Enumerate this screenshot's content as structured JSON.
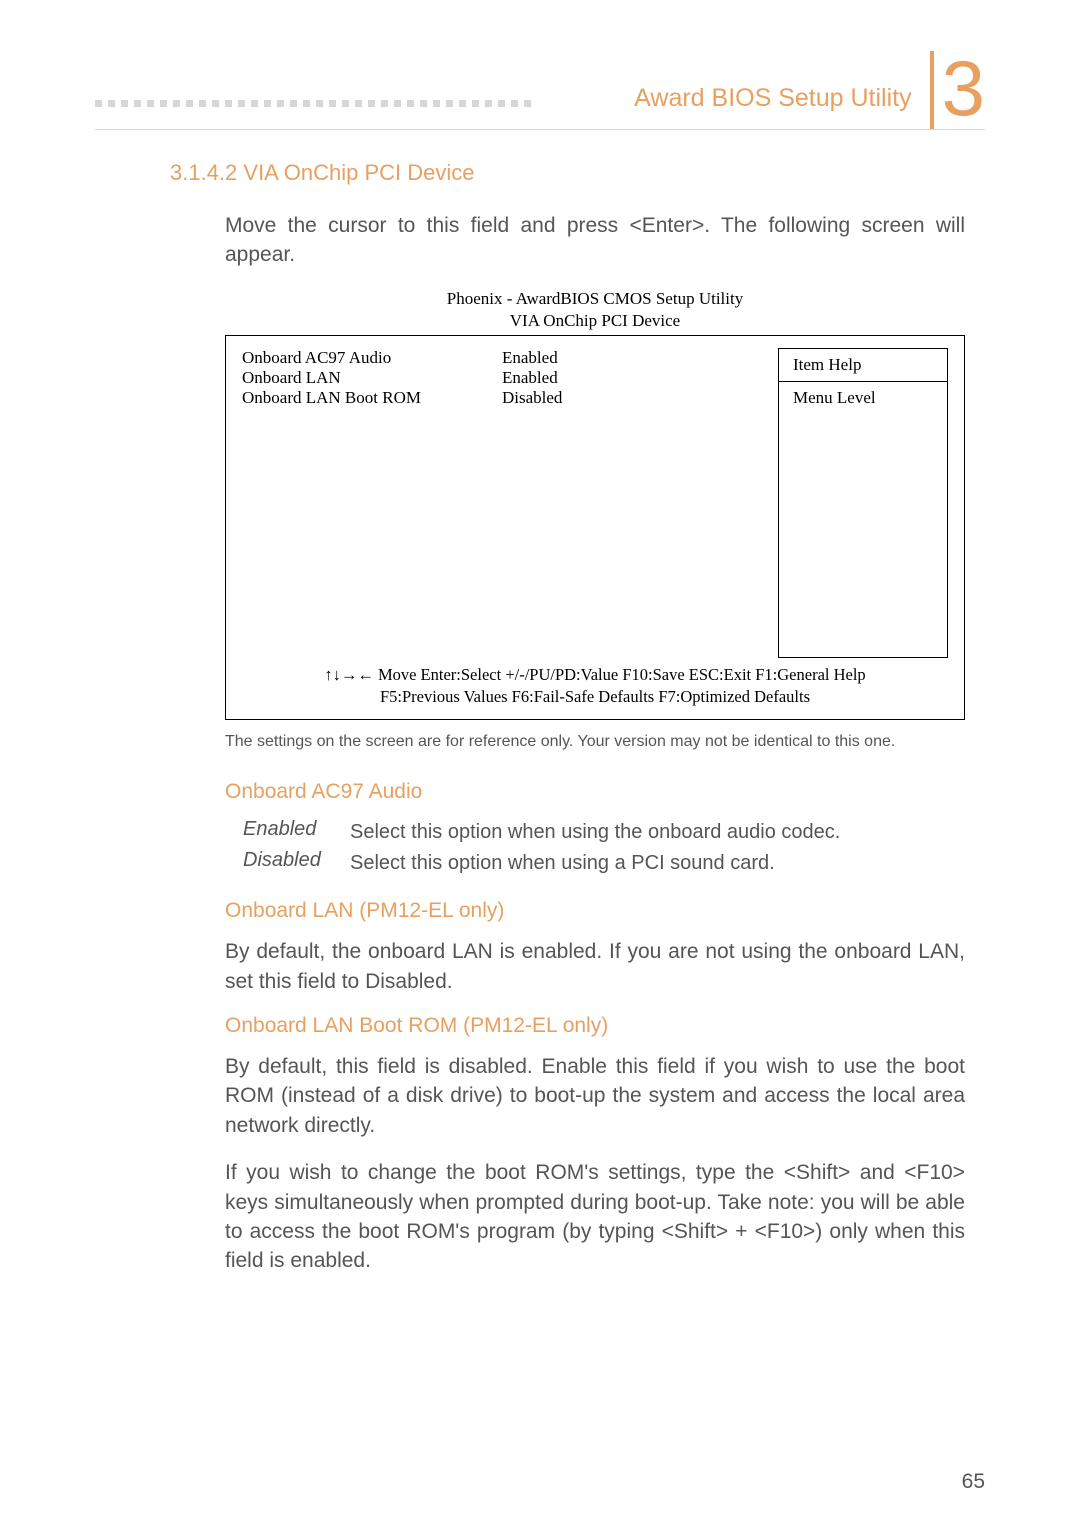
{
  "header": {
    "title": "Award BIOS Setup Utility",
    "chapter_number": "3"
  },
  "section": {
    "number_title": "3.1.4.2  VIA OnChip PCI Device",
    "intro": "Move the cursor to this field and press <Enter>. The following screen will appear."
  },
  "bios": {
    "title_line1": "Phoenix - AwardBIOS CMOS Setup Utility",
    "title_line2": "VIA OnChip PCI Device",
    "rows": [
      {
        "label": "Onboard AC97 Audio",
        "value": "Enabled"
      },
      {
        "label": "Onboard LAN",
        "value": "Enabled"
      },
      {
        "label": "Onboard LAN Boot ROM",
        "value": "Disabled"
      }
    ],
    "help_title": "Item Help",
    "menu_level": "Menu Level",
    "footer_line1": "↑↓→← Move   Enter:Select   +/-/PU/PD:Value   F10:Save   ESC:Exit   F1:General Help",
    "footer_line2": "F5:Previous Values      F6:Fail-Safe Defaults      F7:Optimized Defaults"
  },
  "caption": "The settings on the screen are for reference only. Your version may not be identical to this one.",
  "sub1": {
    "heading": "Onboard AC97 Audio",
    "defs": [
      {
        "term": "Enabled",
        "desc": "Select this option when using the onboard audio codec."
      },
      {
        "term": "Disabled",
        "desc": "Select this option when using a PCI sound card."
      }
    ]
  },
  "sub2": {
    "heading": "Onboard LAN (PM12-EL only)",
    "para": "By default, the onboard LAN is enabled. If you are not using the onboard LAN, set this field to Disabled."
  },
  "sub3": {
    "heading": "Onboard LAN Boot ROM (PM12-EL only)",
    "para1": "By default, this field is disabled. Enable this field if you wish to use the boot ROM (instead of a disk drive) to boot-up the system and access the local area network directly.",
    "para2": "If you wish to change the boot ROM's settings, type the <Shift> and <F10> keys simultaneously when prompted during boot-up. Take note: you will be able to access the boot ROM's program (by typing <Shift> + <F10>) only when this field is enabled."
  },
  "page_number": "65"
}
